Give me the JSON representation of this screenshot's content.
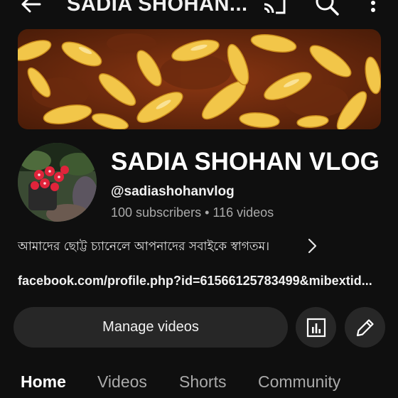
{
  "header": {
    "title": "SADIA SHOHAN...",
    "back_icon": "arrow-left-icon",
    "cast_icon": "cast-icon",
    "search_icon": "search-icon",
    "more_icon": "more-vert-icon"
  },
  "channel": {
    "name": "SADIA SHOHAN VLOG",
    "handle": "@sadiashohanvlog",
    "subscribers": "100 subscribers",
    "separator": "•",
    "videos": "116 videos",
    "description": "আমাদের ছোট্ট চ্যানেলে আপনাদের সবাইকে স্বাগতম।",
    "link": "facebook.com/profile.php?id=61566125783499&mibextid..."
  },
  "actions": {
    "manage_label": "Manage videos",
    "analytics_icon": "analytics-icon",
    "edit_icon": "pencil-icon"
  },
  "tabs": [
    {
      "label": "Home",
      "active": true
    },
    {
      "label": "Videos",
      "active": false
    },
    {
      "label": "Shorts",
      "active": false
    },
    {
      "label": "Community",
      "active": false
    }
  ],
  "colors": {
    "background": "#0f0f0f",
    "button": "#272727",
    "secondary_text": "#aaaaaa"
  }
}
